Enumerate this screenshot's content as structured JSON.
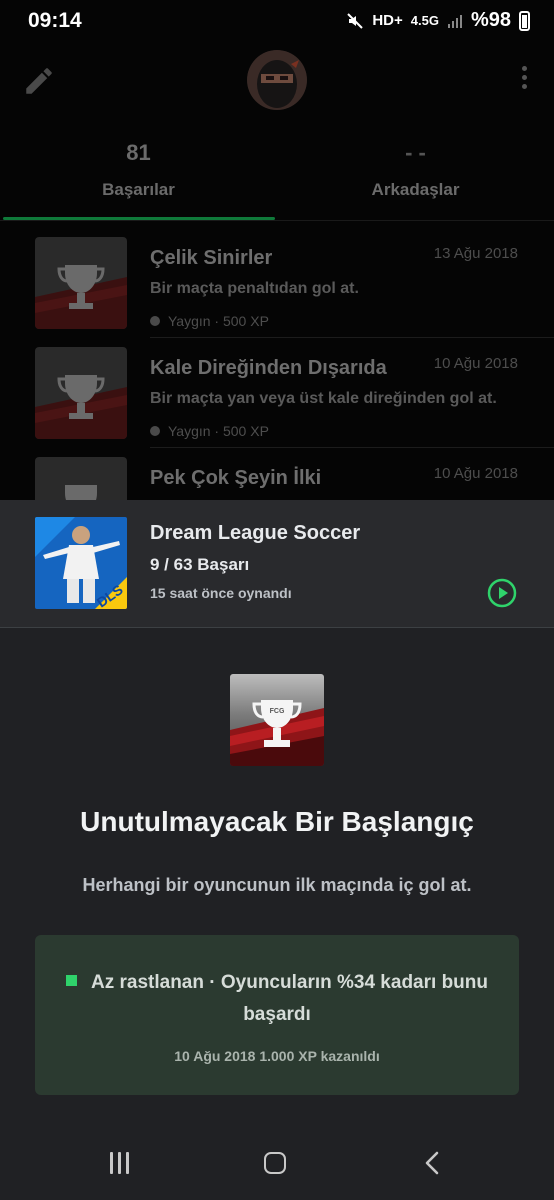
{
  "status_bar": {
    "time": "09:14",
    "network": "HD+",
    "network_type": "4.5G",
    "battery": "%98"
  },
  "profile_tabs": [
    {
      "count": "81",
      "label": "Başarılar"
    },
    {
      "count": "- -",
      "label": "Arkadaşlar"
    }
  ],
  "achievements": [
    {
      "title": "Çelik Sinirler",
      "date": "13 Ağu 2018",
      "description": "Bir maçta penaltıdan gol at.",
      "meta": "Yaygın · 500 XP"
    },
    {
      "title": "Kale Direğinden Dışarıda",
      "date": "10 Ağu 2018",
      "description": "Bir maçta yan veya üst kale direğinden gol at.",
      "meta": "Yaygın · 500 XP"
    },
    {
      "title": "Pek Çok Şeyin İlki",
      "date": "10 Ağu 2018",
      "description": "",
      "meta": ""
    }
  ],
  "game": {
    "title": "Dream League Soccer",
    "progress": "9 / 63 Başarı",
    "last_played": "15 saat önce oynandı",
    "badge": "DLS"
  },
  "detail": {
    "icon_text": "FCG",
    "title": "Unutulmayacak Bir Başlangıç",
    "description": "Herhangi bir oyuncunun ilk maçında iç gol at.",
    "rarity": "Az rastlanan · Oyuncuların %34 kadarı bunu başardı",
    "earned": "10 Ağu 2018 1.000 XP kazanıldı"
  },
  "colors": {
    "accent_green": "#2fd36b",
    "rarity_bg": "#2b3a30",
    "panel_bg": "#202124"
  }
}
